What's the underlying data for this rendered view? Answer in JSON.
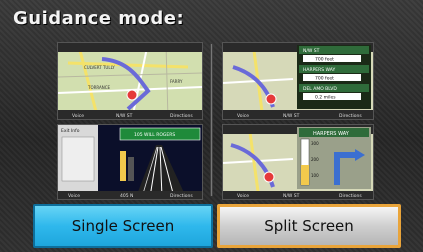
{
  "header": {
    "title": "Guidance mode:"
  },
  "options": {
    "single_label": "Single Screen",
    "split_label": "Split Screen",
    "selected": "Split Screen"
  },
  "previews": {
    "single_map": {
      "street_top": "CULVERT TULLY",
      "street_mid": "TORRANCE",
      "street_right": "FARRY",
      "bottom_left": "Voice",
      "bottom_mid": "N/W ST",
      "bottom_right": "Directions"
    },
    "single_lane": {
      "exit_info": "Exit Info",
      "sign": "105 WILL ROGERS",
      "bottom_left": "Voice",
      "bottom_mid": "405 N",
      "bottom_right": "Directions"
    },
    "split_list": {
      "rows": [
        {
          "name": "N/W ST",
          "dist": "700 feet"
        },
        {
          "name": "HARPERS WAY",
          "dist": "700 feet"
        },
        {
          "name": "DEL AMO BLVD",
          "dist": "0.2 miles"
        }
      ],
      "bottom_left": "Voice",
      "bottom_mid": "N/W ST",
      "bottom_right": "Directions"
    },
    "split_turn": {
      "street": "HARPERS WAY",
      "distances": [
        "300",
        "200",
        "100"
      ],
      "bottom_left": "Voice",
      "bottom_mid": "N/W ST",
      "bottom_right": "Directions"
    }
  },
  "colors": {
    "selected_border": "#e9a43a",
    "single_button": "#2fb8ec",
    "split_button": "#cfcfcf"
  }
}
